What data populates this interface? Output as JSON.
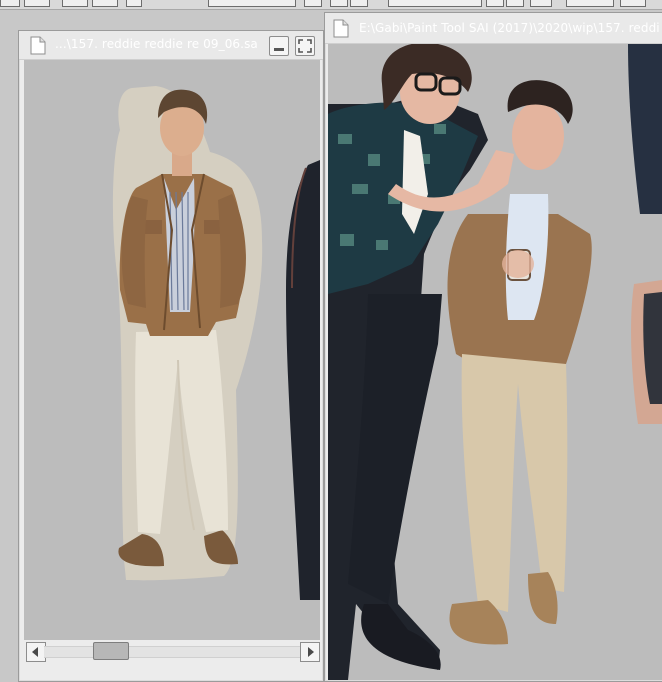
{
  "windows": {
    "reference": {
      "title": "...\\157. reddie reddie re 09_06.sa",
      "scroll_position": 0.22
    },
    "drawing": {
      "title": "E:\\Gabi\\Paint Tool SAI (2017)\\2020\\wip\\157. reddi"
    }
  },
  "icons": {
    "document": "document-icon",
    "minimize": "minimize-icon",
    "maximize": "maximize-icon",
    "scroll_left": "arrow-left-icon",
    "scroll_right": "arrow-right-icon"
  },
  "colors": {
    "window_frame": "#ececec",
    "canvas_bg": "#bcbcbc",
    "title_text": "#ffffff"
  }
}
